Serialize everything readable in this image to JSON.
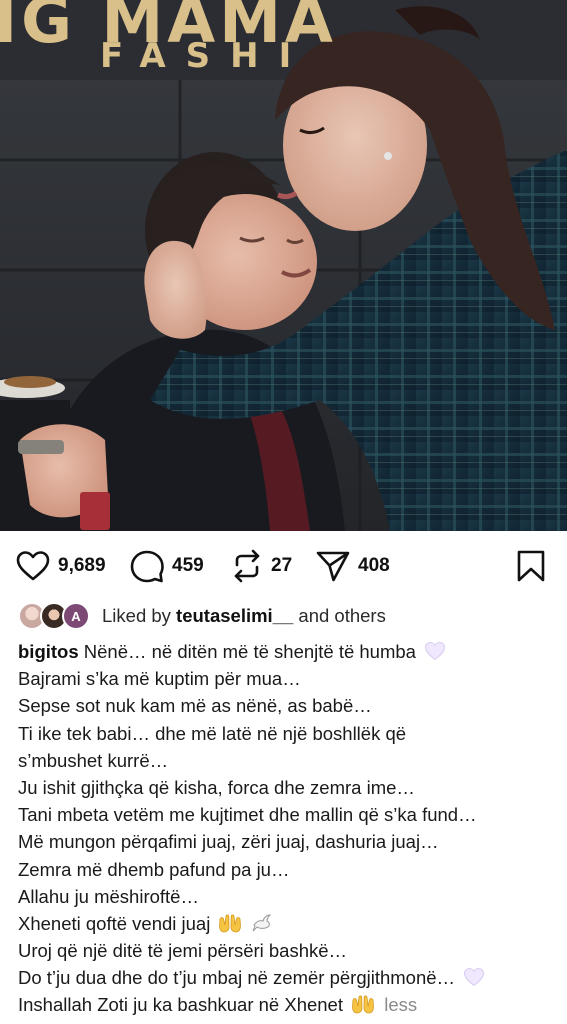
{
  "photo": {
    "sign_top": "IG MAMA",
    "sign_bottom": "FASHI"
  },
  "actions": {
    "likes": "9,689",
    "comments": "459",
    "reposts": "27",
    "shares": "408"
  },
  "liked_by": {
    "prefix": "Liked by ",
    "user": "teutaselimi__",
    "suffix": " and others",
    "avatar3_letter": "A"
  },
  "caption": {
    "username": "bigitos",
    "first_line": " Nënë… në ditën më të shenjtë të humba",
    "lines": [
      "Bajrami s’ka më kuptim për mua…",
      "Sepse sot nuk kam më as nënë, as babë…",
      "Ti ike tek babi… dhe më latë në një boshllëk që",
      "s’mbushet kurrë…",
      "Ju ishit gjithçka që kisha, forca dhe zemra ime…",
      "Tani mbeta vetëm me kujtimet dhe mallin që s’ka fund…",
      "Më mungon përqafimi juaj, zëri juaj, dashuria juaj…",
      "Zemra më dhemb pafund pa ju…",
      "Allahu ju mëshiroftë…"
    ],
    "line_xheneti": "Xheneti qoftë vendi juaj",
    "line_uroj": "Uroj që një ditë të jemi përsëri bashkë…",
    "line_dotju": "Do t’ju dua dhe do t’ju mbaj në zemër përgjithmonë…",
    "line_last": "Inshallah Zoti ju ka bashkuar në Xhenet",
    "less_label": "less"
  },
  "colors": {
    "text": "#0f0f0f",
    "muted": "#8a8a8a",
    "heart_white": "#efe8ff",
    "hands": "#f5c443"
  },
  "icons": {
    "like": "heart-outline-icon",
    "comment": "comment-bubble-icon",
    "repost": "repost-arrows-icon",
    "share": "send-paper-plane-icon",
    "save": "bookmark-icon"
  }
}
